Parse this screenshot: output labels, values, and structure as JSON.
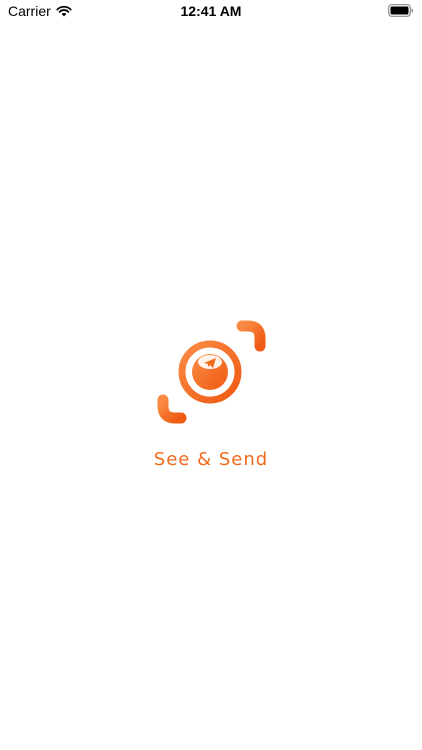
{
  "status_bar": {
    "carrier": "Carrier",
    "time": "12:41 AM",
    "icons": [
      "wifi-icon",
      "battery-icon"
    ]
  },
  "splash": {
    "app_name": "See & Send",
    "logo_icon": "camera-capture-send-icon",
    "colors": {
      "accent": "#f26a1b",
      "accent_light": "#f7833a",
      "background": "#ffffff"
    }
  }
}
